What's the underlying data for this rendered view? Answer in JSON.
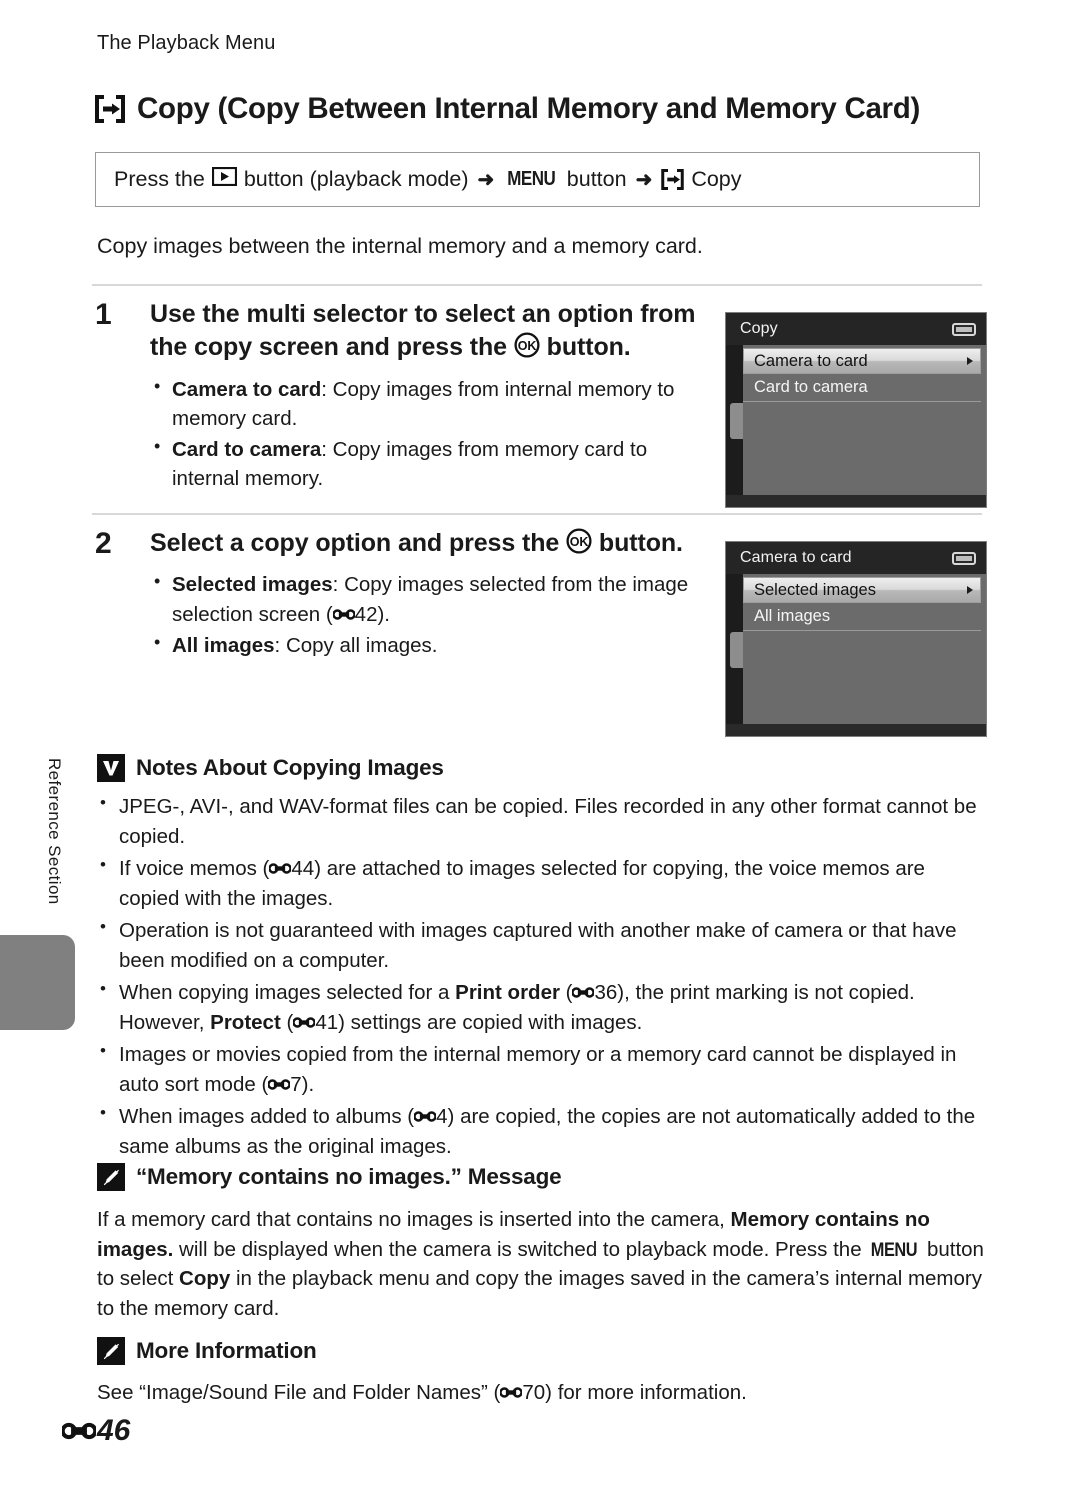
{
  "running_head": "The Playback Menu",
  "side_tab": {
    "label": "Reference Section"
  },
  "title": {
    "icon": "copy-icon",
    "text": "Copy (Copy Between Internal Memory and Memory Card)"
  },
  "menu_path": {
    "prefix": "Press the",
    "playback_icon": "playback-button-icon",
    "mid": "button (playback mode)",
    "arrow1": "➜",
    "menu_label": "MENU",
    "menu_suffix": "button",
    "arrow2": "➜",
    "copy_icon": "copy-icon",
    "target": "Copy"
  },
  "intro": "Copy images between the internal memory and a memory card.",
  "steps": [
    {
      "number": "1",
      "heading_part1": "Use the multi selector to select an option from the copy screen and press the",
      "ok_icon": "ok-button-icon",
      "heading_part2": "button.",
      "bullets": [
        {
          "term": "Camera to card",
          "sep": ": ",
          "text": "Copy images from internal memory to memory card."
        },
        {
          "term": "Card to camera",
          "sep": ": ",
          "text": "Copy images from memory card to internal memory."
        }
      ],
      "screen": {
        "title": "Copy",
        "battery_icon": "battery-icon",
        "selected_item": "Camera to card",
        "selected_arrow_icon": "chevron-right-icon",
        "items": [
          "Card to camera"
        ]
      }
    },
    {
      "number": "2",
      "heading_part1": "Select a copy option and press the",
      "ok_icon": "ok-button-icon",
      "heading_part2": "button.",
      "bullets": [
        {
          "term": "Selected images",
          "sep": ": ",
          "text": "Copy images selected from the image selection screen (",
          "ref": "42",
          "text_after": ")."
        },
        {
          "term": "All images",
          "sep": ": ",
          "text": "Copy all images."
        }
      ],
      "screen": {
        "title": "Camera to card",
        "battery_icon": "battery-icon",
        "selected_item": "Selected images",
        "selected_arrow_icon": "chevron-right-icon",
        "items": [
          "All images"
        ]
      }
    }
  ],
  "notes_section": {
    "mark": "caution-check-icon",
    "title": "Notes About Copying Images",
    "items": [
      {
        "pre": "JPEG-, AVI-, and WAV-format files can be copied. Files recorded in any other format cannot be copied."
      },
      {
        "pre": "If voice memos (",
        "ref": "44",
        "post": ") are attached to images selected for copying, the voice memos are copied with the images."
      },
      {
        "pre": "Operation is not guaranteed with images captured with another make of camera or that have been modified on a computer."
      },
      {
        "pre": "When copying images selected for a ",
        "bold1": "Print order",
        "mid1": " (",
        "ref": "36",
        "mid2": "), the print marking is not copied. However, ",
        "bold2": "Protect",
        "mid3": " (",
        "ref2": "41",
        "post": ") settings are copied with images."
      },
      {
        "pre": "Images or movies copied from the internal memory or a memory card cannot be displayed in auto sort mode (",
        "ref": "7",
        "post": ")."
      },
      {
        "pre": "When images added to albums (",
        "ref": "4",
        "post": ") are copied, the copies are not automatically added to the same albums as the original images."
      }
    ]
  },
  "message_section": {
    "mark": "pencil-note-icon",
    "title": "“Memory contains no images.” Message",
    "body": {
      "p1": "If a memory card that contains no images is inserted into the camera, ",
      "b1": "Memory contains no images.",
      "p2": " will be displayed when the camera is switched to playback mode. Press the ",
      "menu": "MENU",
      "p3": " button to select ",
      "b2": "Copy",
      "p4": " in the playback menu and copy the images saved in the camera’s internal memory to the memory card."
    }
  },
  "more_info_section": {
    "mark": "pencil-note-icon",
    "title": "More Information",
    "body_pre": "See “Image/Sound File and Folder Names” (",
    "ref": "70",
    "body_post": ") for more information."
  },
  "folio": {
    "ref_icon": "reference-mark-icon",
    "page": "46"
  },
  "colors": {
    "text": "#1a1a1a",
    "rule": "#d8d8d8",
    "tab_gray": "#808080",
    "screen_bg": "#6b6b6b",
    "screen_dark": "#1c1c1c"
  }
}
